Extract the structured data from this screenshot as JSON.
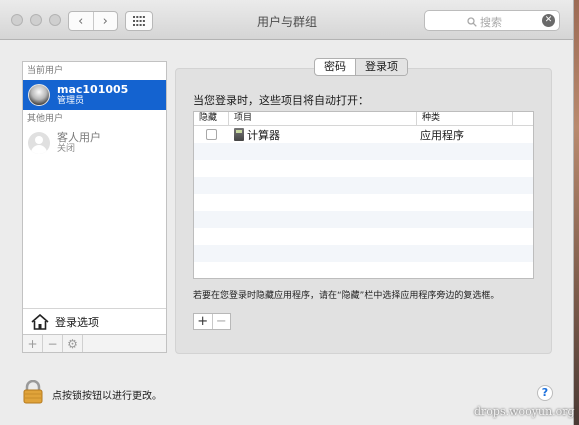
{
  "window": {
    "title": "用户与群组",
    "search_placeholder": "搜索"
  },
  "sidebar": {
    "current_users_label": "当前用户",
    "current_user": {
      "name": "mac101005",
      "role": "管理员"
    },
    "other_users_label": "其他用户",
    "guest_user": {
      "name": "客人用户",
      "status": "关闭"
    },
    "login_options_label": "登录选项",
    "toolbar": {
      "add": "+",
      "remove": "−",
      "gear": "⚙"
    }
  },
  "tabs": [
    {
      "label": "密码",
      "active": false
    },
    {
      "label": "登录项",
      "active": true
    }
  ],
  "login_items": {
    "heading": "当您登录时，这些项目将自动打开：",
    "columns": {
      "hide": "隐藏",
      "item": "项目",
      "kind": "种类"
    },
    "rows": [
      {
        "hidden": false,
        "item": "计算器",
        "kind": "应用程序"
      }
    ],
    "note": "若要在您登录时隐藏应用程序，请在“隐藏”栏中选择应用程序旁边的复选框。",
    "add": "+",
    "remove": "−"
  },
  "footer": {
    "lock_text": "点按锁按钮以进行更改。",
    "help": "?"
  },
  "watermark": "drops.wooyun.org",
  "colors": {
    "selection": "#1463d0",
    "lock": "#e0a33a"
  }
}
